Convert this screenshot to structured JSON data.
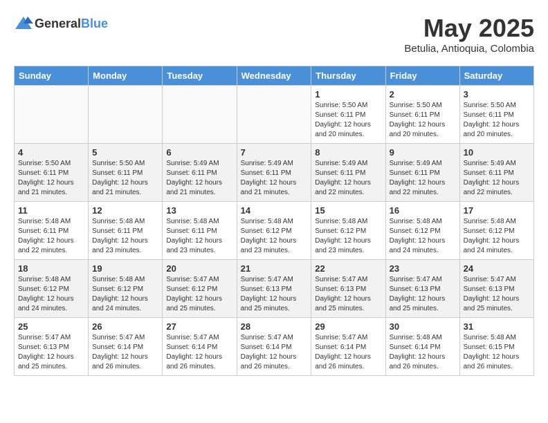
{
  "header": {
    "logo_general": "General",
    "logo_blue": "Blue",
    "month": "May 2025",
    "location": "Betulia, Antioquia, Colombia"
  },
  "days_of_week": [
    "Sunday",
    "Monday",
    "Tuesday",
    "Wednesday",
    "Thursday",
    "Friday",
    "Saturday"
  ],
  "weeks": [
    [
      {
        "day": "",
        "info": ""
      },
      {
        "day": "",
        "info": ""
      },
      {
        "day": "",
        "info": ""
      },
      {
        "day": "",
        "info": ""
      },
      {
        "day": "1",
        "info": "Sunrise: 5:50 AM\nSunset: 6:11 PM\nDaylight: 12 hours\nand 20 minutes."
      },
      {
        "day": "2",
        "info": "Sunrise: 5:50 AM\nSunset: 6:11 PM\nDaylight: 12 hours\nand 20 minutes."
      },
      {
        "day": "3",
        "info": "Sunrise: 5:50 AM\nSunset: 6:11 PM\nDaylight: 12 hours\nand 20 minutes."
      }
    ],
    [
      {
        "day": "4",
        "info": "Sunrise: 5:50 AM\nSunset: 6:11 PM\nDaylight: 12 hours\nand 21 minutes."
      },
      {
        "day": "5",
        "info": "Sunrise: 5:50 AM\nSunset: 6:11 PM\nDaylight: 12 hours\nand 21 minutes."
      },
      {
        "day": "6",
        "info": "Sunrise: 5:49 AM\nSunset: 6:11 PM\nDaylight: 12 hours\nand 21 minutes."
      },
      {
        "day": "7",
        "info": "Sunrise: 5:49 AM\nSunset: 6:11 PM\nDaylight: 12 hours\nand 21 minutes."
      },
      {
        "day": "8",
        "info": "Sunrise: 5:49 AM\nSunset: 6:11 PM\nDaylight: 12 hours\nand 22 minutes."
      },
      {
        "day": "9",
        "info": "Sunrise: 5:49 AM\nSunset: 6:11 PM\nDaylight: 12 hours\nand 22 minutes."
      },
      {
        "day": "10",
        "info": "Sunrise: 5:49 AM\nSunset: 6:11 PM\nDaylight: 12 hours\nand 22 minutes."
      }
    ],
    [
      {
        "day": "11",
        "info": "Sunrise: 5:48 AM\nSunset: 6:11 PM\nDaylight: 12 hours\nand 22 minutes."
      },
      {
        "day": "12",
        "info": "Sunrise: 5:48 AM\nSunset: 6:11 PM\nDaylight: 12 hours\nand 23 minutes."
      },
      {
        "day": "13",
        "info": "Sunrise: 5:48 AM\nSunset: 6:11 PM\nDaylight: 12 hours\nand 23 minutes."
      },
      {
        "day": "14",
        "info": "Sunrise: 5:48 AM\nSunset: 6:12 PM\nDaylight: 12 hours\nand 23 minutes."
      },
      {
        "day": "15",
        "info": "Sunrise: 5:48 AM\nSunset: 6:12 PM\nDaylight: 12 hours\nand 23 minutes."
      },
      {
        "day": "16",
        "info": "Sunrise: 5:48 AM\nSunset: 6:12 PM\nDaylight: 12 hours\nand 24 minutes."
      },
      {
        "day": "17",
        "info": "Sunrise: 5:48 AM\nSunset: 6:12 PM\nDaylight: 12 hours\nand 24 minutes."
      }
    ],
    [
      {
        "day": "18",
        "info": "Sunrise: 5:48 AM\nSunset: 6:12 PM\nDaylight: 12 hours\nand 24 minutes."
      },
      {
        "day": "19",
        "info": "Sunrise: 5:48 AM\nSunset: 6:12 PM\nDaylight: 12 hours\nand 24 minutes."
      },
      {
        "day": "20",
        "info": "Sunrise: 5:47 AM\nSunset: 6:12 PM\nDaylight: 12 hours\nand 25 minutes."
      },
      {
        "day": "21",
        "info": "Sunrise: 5:47 AM\nSunset: 6:13 PM\nDaylight: 12 hours\nand 25 minutes."
      },
      {
        "day": "22",
        "info": "Sunrise: 5:47 AM\nSunset: 6:13 PM\nDaylight: 12 hours\nand 25 minutes."
      },
      {
        "day": "23",
        "info": "Sunrise: 5:47 AM\nSunset: 6:13 PM\nDaylight: 12 hours\nand 25 minutes."
      },
      {
        "day": "24",
        "info": "Sunrise: 5:47 AM\nSunset: 6:13 PM\nDaylight: 12 hours\nand 25 minutes."
      }
    ],
    [
      {
        "day": "25",
        "info": "Sunrise: 5:47 AM\nSunset: 6:13 PM\nDaylight: 12 hours\nand 25 minutes."
      },
      {
        "day": "26",
        "info": "Sunrise: 5:47 AM\nSunset: 6:14 PM\nDaylight: 12 hours\nand 26 minutes."
      },
      {
        "day": "27",
        "info": "Sunrise: 5:47 AM\nSunset: 6:14 PM\nDaylight: 12 hours\nand 26 minutes."
      },
      {
        "day": "28",
        "info": "Sunrise: 5:47 AM\nSunset: 6:14 PM\nDaylight: 12 hours\nand 26 minutes."
      },
      {
        "day": "29",
        "info": "Sunrise: 5:47 AM\nSunset: 6:14 PM\nDaylight: 12 hours\nand 26 minutes."
      },
      {
        "day": "30",
        "info": "Sunrise: 5:48 AM\nSunset: 6:14 PM\nDaylight: 12 hours\nand 26 minutes."
      },
      {
        "day": "31",
        "info": "Sunrise: 5:48 AM\nSunset: 6:15 PM\nDaylight: 12 hours\nand 26 minutes."
      }
    ]
  ]
}
